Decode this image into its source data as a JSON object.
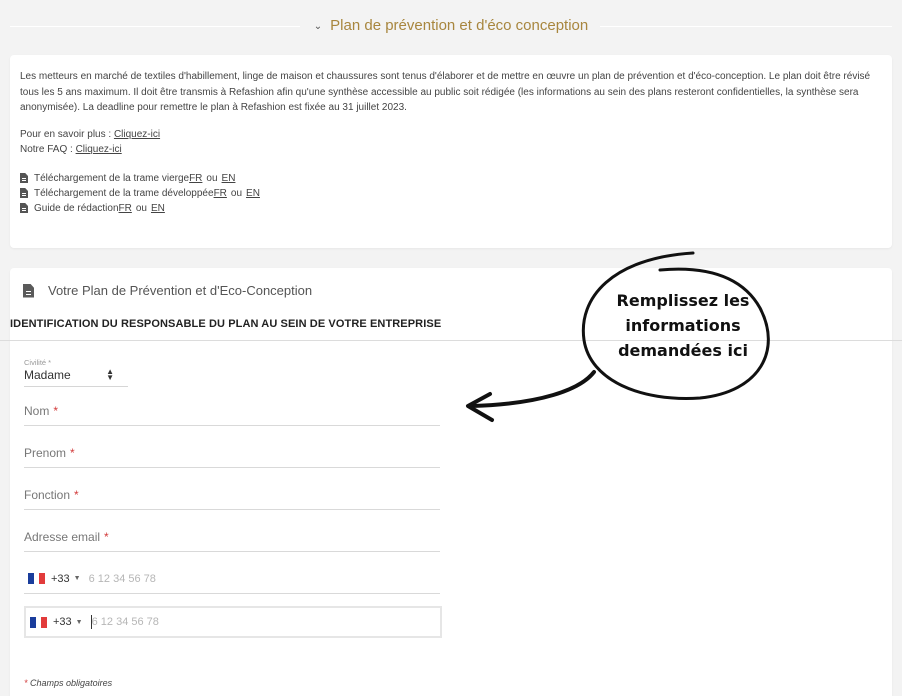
{
  "section": {
    "title": "Plan de prévention et d'éco conception"
  },
  "info": {
    "paragraph": "Les metteurs en marché de textiles d'habillement, linge de maison et chaussures sont tenus d'élaborer et de mettre en œuvre un plan de prévention et d'éco-conception. Le plan doit être révisé tous les 5 ans maximum. Il doit être transmis à Refashion afin qu'une synthèse accessible au public soit rédigée (les informations au sein des plans resteront confidentielles, la synthèse sera anonymisée). La deadline pour remettre le plan à Refashion est fixée au 31 juillet 2023.",
    "learn_more_label": "Pour en savoir plus : ",
    "learn_more_link": "Cliquez-ici",
    "faq_label": "Notre FAQ : ",
    "faq_link": "Cliquez-ici",
    "ou": "ou",
    "downloads": [
      {
        "label": "Téléchargement de la trame vierge ",
        "fr": "FR",
        "en": "EN"
      },
      {
        "label": "Téléchargement de la trame développée ",
        "fr": "FR",
        "en": "EN"
      },
      {
        "label": "Guide de rédaction ",
        "fr": "FR",
        "en": "EN"
      }
    ]
  },
  "form": {
    "title": "Votre Plan de Prévention et d'Eco-Conception",
    "section_heading": "IDENTIFICATION DU RESPONSABLE DU PLAN AU SEIN DE VOTRE ENTREPRISE",
    "civility_label": "Civilité *",
    "civility_value": "Madame",
    "fields": {
      "nom": "Nom",
      "prenom": "Prenom",
      "fonction": "Fonction",
      "email": "Adresse email"
    },
    "required_star": "*",
    "phone_code": "+33",
    "phone_placeholder": "6 12 34 56 78",
    "required_note": "Champs obligatoires"
  },
  "annotation": {
    "line1": "Remplissez les",
    "line2": "informations",
    "line3": "demandées ici"
  },
  "colors": {
    "accent": "#a8863e",
    "required": "#d23b3b",
    "background": "#f3f3f3"
  }
}
